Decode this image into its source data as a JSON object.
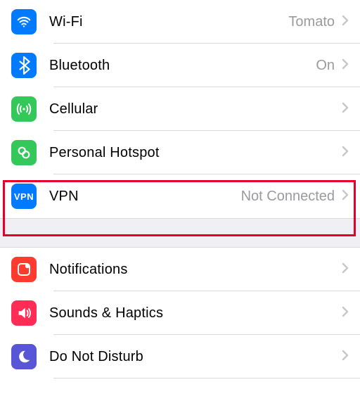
{
  "sections": [
    {
      "rows": [
        {
          "id": "wifi",
          "label": "Wi-Fi",
          "value": "Tomato",
          "icon": "wifi-icon",
          "icon_bg": "bg-blue"
        },
        {
          "id": "bluetooth",
          "label": "Bluetooth",
          "value": "On",
          "icon": "bluetooth-icon",
          "icon_bg": "bg-blue"
        },
        {
          "id": "cellular",
          "label": "Cellular",
          "value": "",
          "icon": "cellular-icon",
          "icon_bg": "bg-green"
        },
        {
          "id": "hotspot",
          "label": "Personal Hotspot",
          "value": "",
          "icon": "hotspot-icon",
          "icon_bg": "bg-green"
        },
        {
          "id": "vpn",
          "label": "VPN",
          "value": "Not Connected",
          "icon": "vpn-icon",
          "icon_bg": "bg-blue",
          "highlighted": true
        }
      ]
    },
    {
      "rows": [
        {
          "id": "notifications",
          "label": "Notifications",
          "value": "",
          "icon": "notifications-icon",
          "icon_bg": "bg-red"
        },
        {
          "id": "sounds",
          "label": "Sounds & Haptics",
          "value": "",
          "icon": "sounds-icon",
          "icon_bg": "bg-pink"
        },
        {
          "id": "dnd",
          "label": "Do Not Disturb",
          "value": "",
          "icon": "dnd-icon",
          "icon_bg": "bg-purple"
        }
      ]
    }
  ],
  "colors": {
    "accent": "#007aff",
    "highlight": "#e4002b",
    "separator": "#d9d9dc",
    "group_bg": "#efeff4",
    "value_text": "#9a9a9f"
  }
}
